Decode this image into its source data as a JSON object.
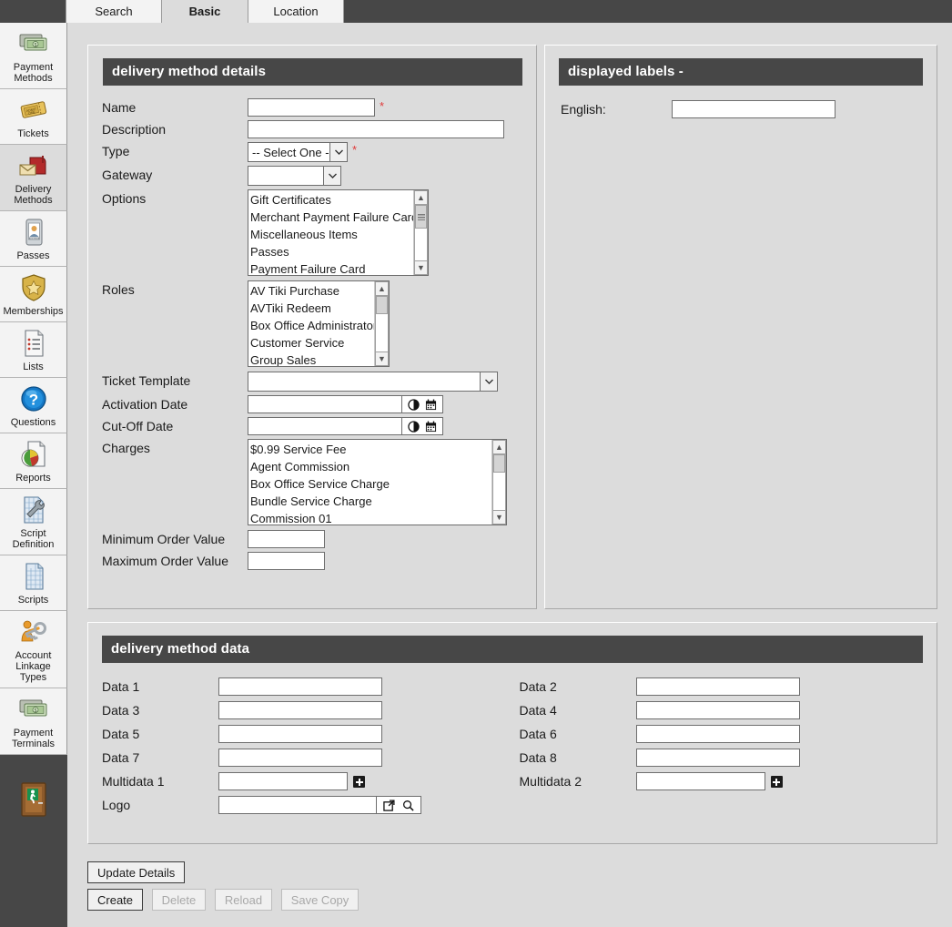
{
  "tabs": [
    {
      "label": "Search",
      "active": false
    },
    {
      "label": "Basic",
      "active": true
    },
    {
      "label": "Location",
      "active": false
    }
  ],
  "sidebar": {
    "items": [
      {
        "label": "Payment\nMethods",
        "icon": "banknotes-icon",
        "selected": false
      },
      {
        "label": "Tickets",
        "icon": "ticket-icon",
        "selected": false
      },
      {
        "label": "Delivery\nMethods",
        "icon": "mailbox-icon",
        "selected": true
      },
      {
        "label": "Passes",
        "icon": "pass-card-icon",
        "selected": false
      },
      {
        "label": "Memberships",
        "icon": "shield-star-icon",
        "selected": false
      },
      {
        "label": "Lists",
        "icon": "list-document-icon",
        "selected": false
      },
      {
        "label": "Questions",
        "icon": "question-mark-icon",
        "selected": false
      },
      {
        "label": "Reports",
        "icon": "pie-chart-report-icon",
        "selected": false
      },
      {
        "label": "Script\nDefinition",
        "icon": "wrench-grid-icon",
        "selected": false
      },
      {
        "label": "Scripts",
        "icon": "grid-document-icon",
        "selected": false
      },
      {
        "label": "Account\nLinkage Types",
        "icon": "person-key-icon",
        "selected": false
      },
      {
        "label": "Payment\nTerminals",
        "icon": "banknotes-icon",
        "selected": false
      }
    ],
    "exit": {
      "icon": "exit-door-icon",
      "label": ""
    }
  },
  "details_panel": {
    "title": "delivery method details",
    "fields": {
      "name": {
        "label": "Name",
        "value": "",
        "required": true
      },
      "description": {
        "label": "Description",
        "value": "",
        "required": false
      },
      "type": {
        "label": "Type",
        "value": "-- Select One --",
        "required": true
      },
      "gateway": {
        "label": "Gateway",
        "value": "",
        "required": false
      },
      "options": {
        "label": "Options",
        "items": [
          "Gift Certificates",
          "Merchant Payment Failure Card",
          "Miscellaneous Items",
          "Passes",
          "Payment Failure Card"
        ]
      },
      "roles": {
        "label": "Roles",
        "items": [
          "AV Tiki Purchase",
          "AVTiki Redeem",
          "Box Office Administrator",
          "Customer Service",
          "Group Sales"
        ]
      },
      "ticket_template": {
        "label": "Ticket Template",
        "value": ""
      },
      "activation_date": {
        "label": "Activation Date",
        "value": ""
      },
      "cut_off_date": {
        "label": "Cut-Off Date",
        "value": ""
      },
      "charges": {
        "label": "Charges",
        "items": [
          "$0.99 Service Fee",
          "Agent Commission",
          "Box Office Service Charge",
          "Bundle Service Charge",
          "Commission 01"
        ]
      },
      "minimum_order_value": {
        "label": "Minimum Order Value",
        "value": ""
      },
      "maximum_order_value": {
        "label": "Maximum Order Value",
        "value": ""
      }
    }
  },
  "labels_panel": {
    "title": "displayed labels -",
    "english": {
      "label": "English:",
      "value": ""
    }
  },
  "data_panel": {
    "title": "delivery method data",
    "left": [
      {
        "label": "Data 1",
        "value": "",
        "type": "text"
      },
      {
        "label": "Data 3",
        "value": "",
        "type": "text"
      },
      {
        "label": "Data 5",
        "value": "",
        "type": "text"
      },
      {
        "label": "Data 7",
        "value": "",
        "type": "text"
      },
      {
        "label": "Multidata 1",
        "value": "",
        "type": "multi"
      },
      {
        "label": "Logo",
        "value": "",
        "type": "logo"
      }
    ],
    "right": [
      {
        "label": "Data 2",
        "value": "",
        "type": "text"
      },
      {
        "label": "Data 4",
        "value": "",
        "type": "text"
      },
      {
        "label": "Data 6",
        "value": "",
        "type": "text"
      },
      {
        "label": "Data 8",
        "value": "",
        "type": "text"
      },
      {
        "label": "Multidata 2",
        "value": "",
        "type": "multi"
      }
    ]
  },
  "buttons": {
    "update_details": {
      "label": "Update Details",
      "enabled": true
    },
    "create": {
      "label": "Create",
      "enabled": true
    },
    "delete": {
      "label": "Delete",
      "enabled": false
    },
    "reload": {
      "label": "Reload",
      "enabled": false
    },
    "save_copy": {
      "label": "Save Copy",
      "enabled": false
    }
  },
  "colors": {
    "header_bar": "#474747",
    "page_bg": "#dcdcdc",
    "required_star": "#e03a3a"
  }
}
